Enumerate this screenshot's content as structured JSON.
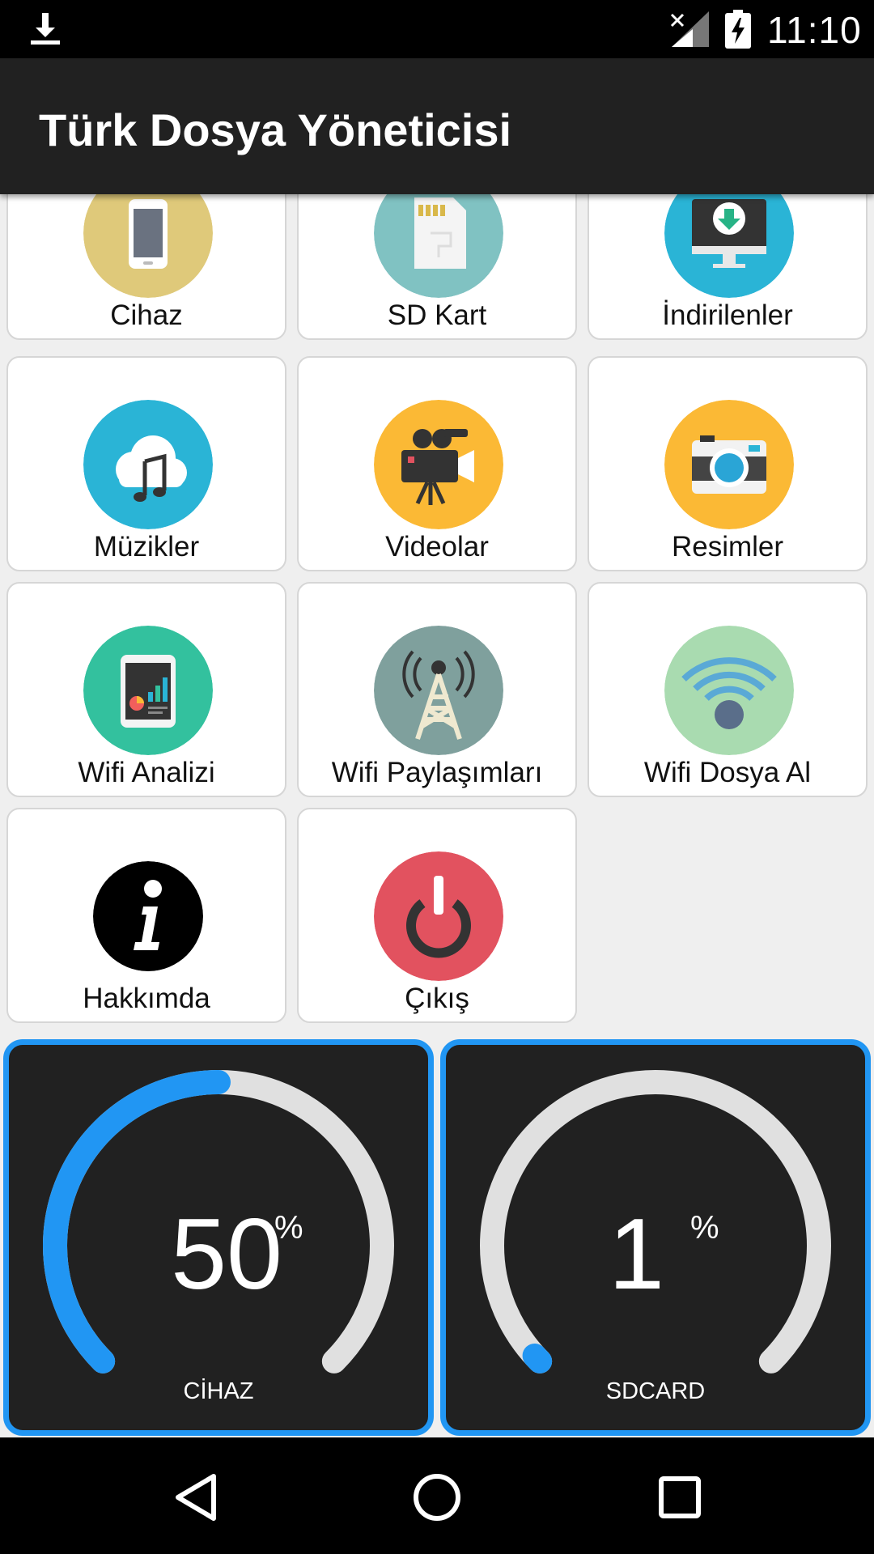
{
  "status_bar": {
    "time": "11:10"
  },
  "app_bar": {
    "title": "Türk Dosya Yöneticisi"
  },
  "tiles": [
    {
      "label": "Cihaz",
      "icon": "phone-icon",
      "color": "#dfc97a"
    },
    {
      "label": "SD Kart",
      "icon": "sd-card-icon",
      "color": "#80c2c2"
    },
    {
      "label": "İndirilenler",
      "icon": "download-monitor-icon",
      "color": "#2ab4d6"
    },
    {
      "label": "Müzikler",
      "icon": "music-cloud-icon",
      "color": "#2ab4d6"
    },
    {
      "label": "Videolar",
      "icon": "video-camera-icon",
      "color": "#fbb935"
    },
    {
      "label": "Resimler",
      "icon": "photo-camera-icon",
      "color": "#fbb935"
    },
    {
      "label": "Wifi Analizi",
      "icon": "wifi-analysis-icon",
      "color": "#33c19e"
    },
    {
      "label": "Wifi Paylaşımları",
      "icon": "antenna-tower-icon",
      "color": "#7fa09d"
    },
    {
      "label": "Wifi Dosya Al",
      "icon": "wifi-icon",
      "color": "#a9dbb0"
    },
    {
      "label": "Hakkımda",
      "icon": "info-icon",
      "color": "#000000"
    },
    {
      "label": "Çıkış",
      "icon": "power-icon",
      "color": "#e2525f"
    }
  ],
  "gauges": [
    {
      "value": "50",
      "unit": "%",
      "label": "CİHAZ",
      "percent": 50
    },
    {
      "value": "1",
      "unit": "%",
      "label": "SDCARD",
      "percent": 1
    }
  ],
  "colors": {
    "accent": "#2196f3",
    "track": "#e0e0e0",
    "card": "#212121"
  }
}
